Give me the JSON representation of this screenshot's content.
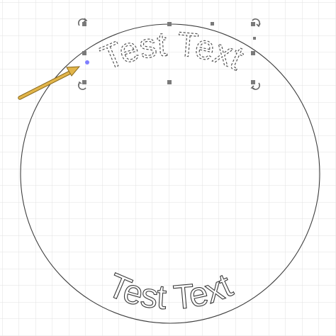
{
  "canvas": {
    "grid_color": "#e2e2e2",
    "background": "#ffffff",
    "circle_stroke": "#3f3f3f"
  },
  "top_text": {
    "text": "Test Text",
    "selected": true,
    "style": "dashed-outline"
  },
  "bottom_text": {
    "text": "Test Text",
    "selected": false,
    "style": "outline"
  },
  "selection": {
    "handle_color": "#7a7a7a",
    "rotate_icon": "rotate-arrow-icon",
    "anchor_point_color": "#7f7fff"
  },
  "pointer": {
    "icon": "arrow-pointer-icon",
    "color": "#e2b54a"
  }
}
